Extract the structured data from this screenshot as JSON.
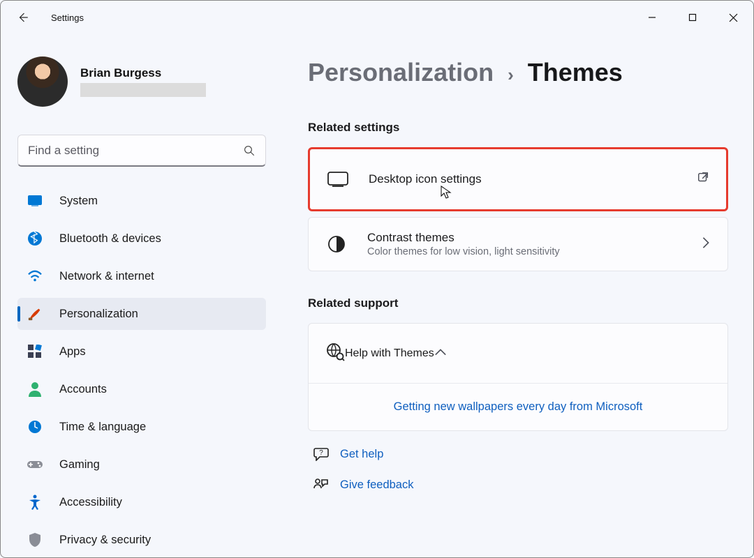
{
  "titlebar": {
    "app_name": "Settings"
  },
  "user": {
    "display_name": "Brian Burgess"
  },
  "search": {
    "placeholder": "Find a setting"
  },
  "nav": {
    "system": "System",
    "bluetooth": "Bluetooth & devices",
    "network": "Network & internet",
    "personalization": "Personalization",
    "apps": "Apps",
    "accounts": "Accounts",
    "time": "Time & language",
    "gaming": "Gaming",
    "accessibility": "Accessibility",
    "privacy": "Privacy & security"
  },
  "breadcrumb": {
    "parent": "Personalization",
    "current": "Themes"
  },
  "sections": {
    "related_settings": "Related settings",
    "related_support": "Related support"
  },
  "cards": {
    "desktop_icons": {
      "title": "Desktop icon settings"
    },
    "contrast": {
      "title": "Contrast themes",
      "subtitle": "Color themes for low vision, light sensitivity"
    },
    "help_themes": {
      "title": "Help with Themes"
    },
    "wallpaper_link": "Getting new wallpapers every day from Microsoft"
  },
  "links": {
    "get_help": "Get help",
    "give_feedback": "Give feedback"
  }
}
